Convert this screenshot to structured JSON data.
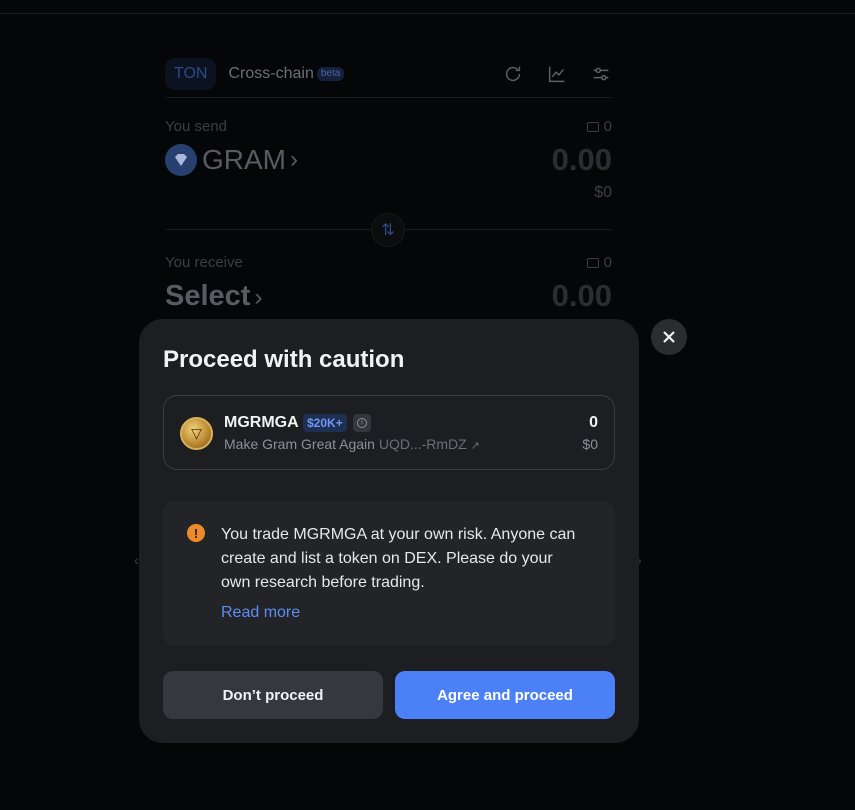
{
  "swap": {
    "tabs": [
      {
        "label": "TON"
      },
      {
        "label": "Cross-chain",
        "badge": "beta"
      }
    ],
    "header_icons": [
      "refresh-icon",
      "chart-icon",
      "settings-icon"
    ],
    "send": {
      "label": "You send",
      "balance": "0",
      "token": "GRAM",
      "amount": "0.00",
      "usd": "$0"
    },
    "receive": {
      "label": "You receive",
      "balance": "0",
      "token": "Select",
      "amount": "0.00"
    }
  },
  "modal": {
    "title": "Proceed with caution",
    "token": {
      "symbol": "MGRMGA",
      "badge": "$20K+",
      "name": "Make Gram Great Again",
      "address": "UQD...-RmDZ",
      "link_icon": "↗",
      "amount": "0",
      "usd": "$0"
    },
    "warning": {
      "text": "You trade MGRMGA at your own risk. Anyone can create and list a token on DEX. Please do your own research before trading.",
      "link": "Read more"
    },
    "buttons": {
      "decline": "Don’t proceed",
      "accept": "Agree and proceed"
    }
  },
  "colors": {
    "accent": "#4b80f6",
    "warning": "#ef8a2a",
    "modal_bg": "#1c1e21"
  }
}
